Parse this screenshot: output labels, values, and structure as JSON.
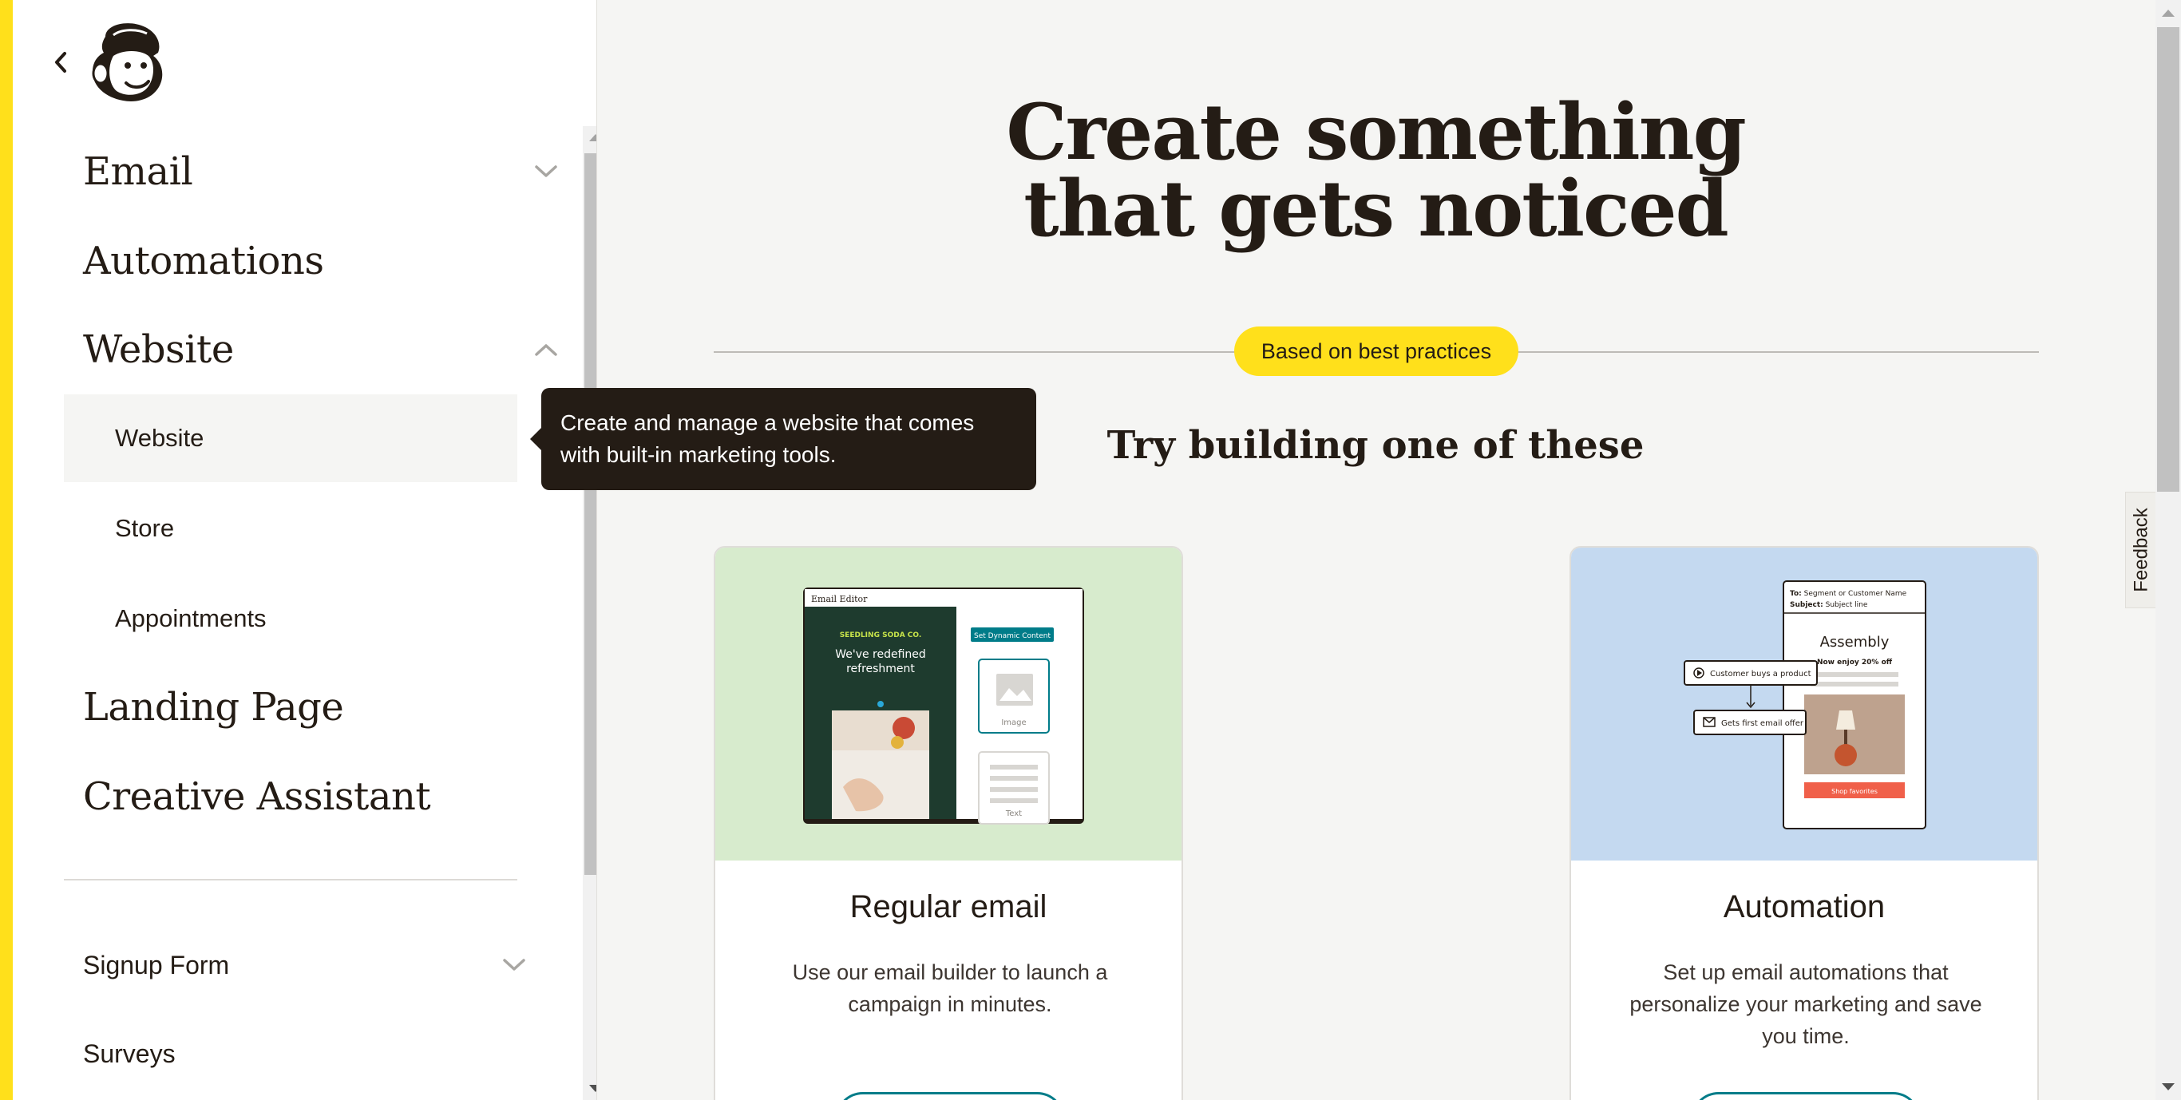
{
  "sidebar": {
    "back_icon": "chevron-left-icon",
    "logo_icon": "freddie-monkey-logo",
    "nav": [
      {
        "label": "Email",
        "chevron": "down"
      },
      {
        "label": "Automations"
      },
      {
        "label": "Website",
        "chevron": "up"
      },
      {
        "label": "Landing Page"
      },
      {
        "label": "Creative Assistant"
      }
    ],
    "website_sub": [
      {
        "label": "Website",
        "active": true
      },
      {
        "label": "Store"
      },
      {
        "label": "Appointments"
      }
    ],
    "secondary_nav": [
      {
        "label": "Signup Form",
        "chevron": "down"
      },
      {
        "label": "Surveys"
      }
    ]
  },
  "tooltip": {
    "text": "Create and manage a website that comes with built-in marketing tools."
  },
  "main": {
    "title": "Create something that gets noticed",
    "badge": "Based on best practices",
    "subtitle": "Try building one of these",
    "cards": [
      {
        "title": "Regular email",
        "description": "Use our email builder to launch a campaign in minutes.",
        "image_bg": "#d7ebcd",
        "mock": {
          "window_title": "Email Editor",
          "brand": "SEEDLING SODA CO.",
          "headline": "We've redefined refreshment",
          "dynamic_button": "Set Dynamic Content",
          "image_label": "Image",
          "text_label": "Text"
        }
      },
      {
        "title": "Automation",
        "description": "Set up email automations that personalize your marketing and save you time.",
        "image_bg": "#c4d9f0",
        "mock": {
          "to_label": "To:",
          "to_value": "Segment or Customer Name",
          "subject_label": "Subject:",
          "subject_value": "Subject line",
          "brand": "Assembly",
          "offer": "Now enjoy 20% off",
          "trigger": "Customer buys a product",
          "action": "Gets first email offer",
          "cta": "Shop favorites"
        }
      }
    ]
  },
  "feedback": {
    "label": "Feedback"
  },
  "colors": {
    "accent_yellow": "#ffe01b",
    "ink": "#241c15",
    "teal": "#007c89",
    "background": "#f5f5f3"
  }
}
